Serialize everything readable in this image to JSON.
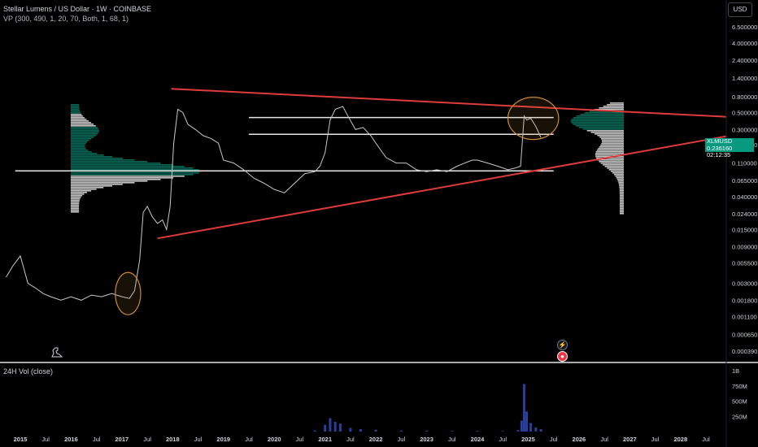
{
  "header": {
    "title": "Stellar Lumens / US Dollar · 1W · COINBASE",
    "indicator": "VP (300, 490, 1, 20, 70, Both, 1, 68, 1)",
    "currency_button": "USD",
    "volume_pane_title": "24H Vol (close)"
  },
  "price_tag": {
    "symbol": "XLMUSD",
    "price": "0.236160",
    "countdown": "02:12:35"
  },
  "colors": {
    "background": "#000000",
    "candles": "#c8c8c8",
    "trendline": "#e03b3b",
    "vp_teal": "#0d7a66",
    "vp_white": "#e6e6e6",
    "circle": "#c88a3a",
    "volume": "#2a3f9a"
  },
  "icons": {
    "dino": "dino-icon",
    "flash": "flash-icon",
    "event": "red-event-icon"
  },
  "chart_data": {
    "type": "candlestick-line",
    "scale": "log",
    "ylim": [
      0.0003,
      12
    ],
    "y_tick_labels": [
      "6.500000",
      "4.000000",
      "2.400000",
      "1.400000",
      "0.800000",
      "0.500000",
      "0.300000",
      "0.190000",
      "0.110000",
      "0.065000",
      "0.040000",
      "0.024000",
      "0.015000",
      "0.009000",
      "0.005500",
      "0.003000",
      "0.001800",
      "0.001100",
      "0.000650",
      "0.000390"
    ],
    "x_tick_labels": [
      "2015",
      "Jul",
      "2016",
      "Jul",
      "2017",
      "Jul",
      "2018",
      "Jul",
      "2019",
      "Jul",
      "2020",
      "Jul",
      "2021",
      "Jul",
      "2022",
      "Jul",
      "2023",
      "Jul",
      "2024",
      "Jul",
      "2025",
      "Jul",
      "2026",
      "Jul",
      "2027",
      "Jul",
      "2028",
      "Jul"
    ],
    "xlim": [
      2014.6,
      2028.9
    ],
    "series": [
      {
        "x": [
          2014.72,
          2014.85,
          2015.0,
          2015.15,
          2015.3,
          2015.45,
          2015.6,
          2015.8,
          2016.0,
          2016.2,
          2016.4,
          2016.6,
          2016.8,
          2017.0,
          2017.15,
          2017.25,
          2017.35,
          2017.42,
          2017.5,
          2017.6,
          2017.7,
          2017.8,
          2017.88,
          2017.95,
          2018.02,
          2018.1,
          2018.2,
          2018.3,
          2018.45,
          2018.6,
          2018.75,
          2018.9,
          2019.0,
          2019.2,
          2019.4,
          2019.6,
          2019.8,
          2020.0,
          2020.2,
          2020.4,
          2020.6,
          2020.8,
          2020.9,
          2021.0,
          2021.1,
          2021.2,
          2021.35,
          2021.45,
          2021.6,
          2021.75,
          2021.9,
          2022.0,
          2022.2,
          2022.4,
          2022.6,
          2022.8,
          2023.0,
          2023.2,
          2023.4,
          2023.6,
          2023.75,
          2023.9,
          2024.0,
          2024.2,
          2024.4,
          2024.6,
          2024.75,
          2024.85,
          2024.92,
          2024.97,
          2025.05,
          2025.15,
          2025.25
        ],
        "values": [
          0.0036,
          0.005,
          0.0068,
          0.003,
          0.0026,
          0.0022,
          0.002,
          0.0018,
          0.002,
          0.0018,
          0.0021,
          0.002,
          0.0022,
          0.002,
          0.0019,
          0.0024,
          0.006,
          0.025,
          0.03,
          0.022,
          0.018,
          0.02,
          0.015,
          0.03,
          0.2,
          0.55,
          0.5,
          0.35,
          0.3,
          0.25,
          0.23,
          0.2,
          0.12,
          0.11,
          0.09,
          0.07,
          0.06,
          0.05,
          0.045,
          0.06,
          0.08,
          0.085,
          0.1,
          0.15,
          0.4,
          0.55,
          0.6,
          0.45,
          0.3,
          0.32,
          0.25,
          0.2,
          0.13,
          0.11,
          0.11,
          0.09,
          0.085,
          0.09,
          0.085,
          0.1,
          0.11,
          0.12,
          0.12,
          0.11,
          0.1,
          0.09,
          0.095,
          0.1,
          0.45,
          0.4,
          0.42,
          0.33,
          0.236
        ]
      }
    ],
    "trendlines": [
      {
        "x": [
          2017.97,
          2028.9
        ],
        "y": [
          1.02,
          0.44
        ]
      },
      {
        "x": [
          2017.7,
          2028.9
        ],
        "y": [
          0.0115,
          0.245
        ]
      }
    ],
    "horizontal_levels": [
      {
        "value": 0.43,
        "x": [
          2019.5,
          2025.5
        ]
      },
      {
        "value": 0.26,
        "x": [
          2019.5,
          2025.5
        ]
      },
      {
        "value": 0.087,
        "x": [
          2014.9,
          2025.5
        ]
      }
    ],
    "highlight_ellipses": [
      {
        "x": 2017.12,
        "y": 0.0022,
        "w": 0.5,
        "h": 0.55
      },
      {
        "x": 2025.1,
        "y": 0.42,
        "w": 1.0,
        "h": 0.55
      }
    ],
    "volume": {
      "tick_labels": [
        "1B",
        "750M",
        "500M",
        "250M"
      ],
      "ylim": [
        0,
        1000000000
      ],
      "x": [
        2020.8,
        2021.0,
        2021.1,
        2021.2,
        2021.3,
        2021.5,
        2021.7,
        2022.0,
        2022.5,
        2023.0,
        2023.5,
        2024.0,
        2024.5,
        2024.8,
        2024.87,
        2024.92,
        2024.97,
        2025.05,
        2025.15,
        2025.25
      ],
      "values": [
        20000000,
        110000000,
        220000000,
        160000000,
        130000000,
        60000000,
        40000000,
        30000000,
        15000000,
        15000000,
        12000000,
        12000000,
        10000000,
        25000000,
        180000000,
        780000000,
        330000000,
        140000000,
        70000000,
        40000000
      ]
    }
  }
}
